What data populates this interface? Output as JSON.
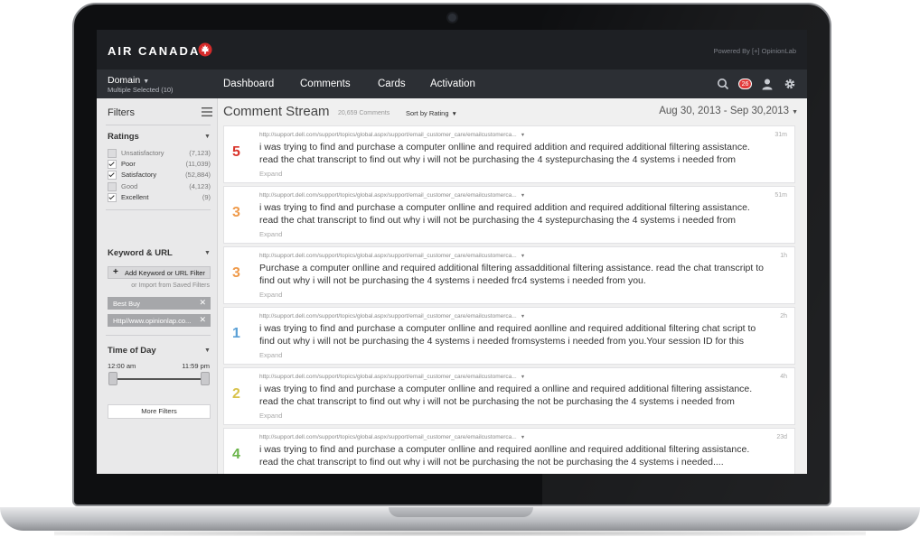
{
  "header": {
    "brand": "AIR CANADA",
    "powered_by": "Powered By [+] OpinionLab"
  },
  "nav": {
    "domain_label": "Domain",
    "domain_selection": "Multiple Selected (10)",
    "tabs": [
      "Dashboard",
      "Comments",
      "Cards",
      "Activation"
    ],
    "notification_count": "26",
    "icons": [
      "search-icon",
      "notification-badge",
      "user-icon",
      "gear-icon"
    ]
  },
  "sidebar": {
    "title": "Filters",
    "ratings": {
      "title": "Ratings",
      "items": [
        {
          "label": "Unsatisfactory",
          "count": "(7,123)",
          "checked": false
        },
        {
          "label": "Poor",
          "count": "(11,039)",
          "checked": true
        },
        {
          "label": "Satisfactory",
          "count": "(52,884)",
          "checked": true
        },
        {
          "label": "Good",
          "count": "(4,123)",
          "checked": false
        },
        {
          "label": "Excellent",
          "count": "(9)",
          "checked": true
        }
      ]
    },
    "keyword_url": {
      "title": "Keyword & URL",
      "add_label": "Add Keyword or URL Filter",
      "import_label": "or Import from Saved Filters",
      "chips": [
        "Best Buy",
        "Http//www.opinionlap.co..."
      ]
    },
    "time_of_day": {
      "title": "Time of Day",
      "start": "12:00 am",
      "end": "11:59 pm"
    },
    "more_filters": "More Filters"
  },
  "stream": {
    "title": "Comment Stream",
    "count": "20,659 Comments",
    "sort_label": "Sort by Rating",
    "date_range": "Aug 30, 2013 - Sep 30,2013",
    "expand_label": "Expand",
    "cards": [
      {
        "rating": "5",
        "color": "#d9342b",
        "url": "http://support.dell.com/support/topics/global.aspx/support/email_customer_care/emailcustomerca...",
        "time": "31m",
        "text": "i was trying to find and purchase a computer onlline and required addition and required additional filtering assistance. read the chat transcript to find out why i will not be purchasing the 4 systepurchasing the 4 systems i needed from"
      },
      {
        "rating": "3",
        "color": "#ef9a4a",
        "url": "http://support.dell.com/support/topics/global.aspx/support/email_customer_care/emailcustomerca...",
        "time": "51m",
        "text": "i was trying to find and purchase a computer onlline and required addition and required additional filtering assistance. read the chat transcript to find out why i will not be purchasing the 4 systepurchasing the 4 systems i needed from"
      },
      {
        "rating": "3",
        "color": "#ef9a4a",
        "url": "http://support.dell.com/support/topics/global.aspx/support/email_customer_care/emailcustomerca...",
        "time": "1h",
        "text": "Purchase a computer onlline and required additional filtering assadditional filtering assistance. read the chat transcript to find out why i will not be purchasing the 4 systems i needed frc4 systems i needed from you."
      },
      {
        "rating": "1",
        "color": "#5aa0d6",
        "url": "http://support.dell.com/support/topics/global.aspx/support/email_customer_care/emailcustomerca...",
        "time": "2h",
        "text": "i was trying to find and purchase a computer onlline and required aonlline and required additional filtering chat script to find out why i will not be purchasing the 4 systems i needed fromsystems i needed from you.Your session ID for this"
      },
      {
        "rating": "2",
        "color": "#d8c24a",
        "url": "http://support.dell.com/support/topics/global.aspx/support/email_customer_care/emailcustomerca...",
        "time": "4h",
        "text": "i was trying to find and purchase a computer onlline and required a onlline and required additional filtering assistance. read the chat transcript to find out why i will not be purchasing the not be purchasing the 4 systems i needed from"
      },
      {
        "rating": "4",
        "color": "#6ab44a",
        "url": "http://support.dell.com/support/topics/global.aspx/support/email_customer_care/emailcustomerca...",
        "time": "23d",
        "text": "i was trying to find and purchase a computer onlline and required aonlline and required additional filtering assistance. read the chat transcript to find out why i will not be purchasing the not be purchasing the 4 systems i needed...."
      }
    ]
  }
}
